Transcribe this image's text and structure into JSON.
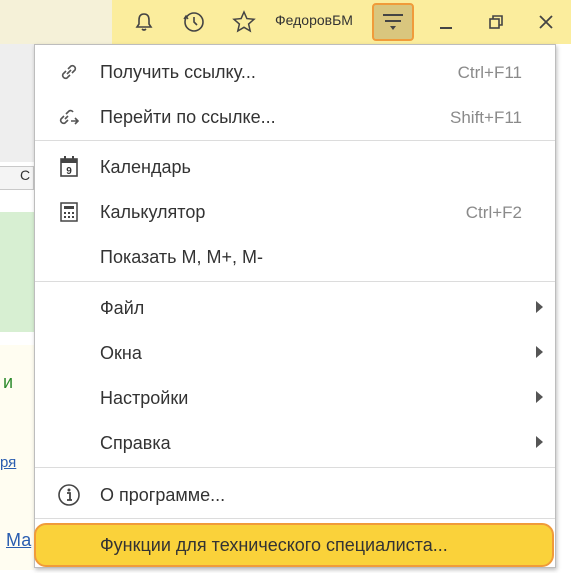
{
  "titlebar": {
    "user_name": "ФедоровБМ",
    "icons": [
      "bell-icon",
      "history-icon",
      "star-icon",
      "menu-icon",
      "minimize-icon",
      "restore-icon",
      "close-icon"
    ]
  },
  "background": {
    "button_label": "С",
    "text_green": "и",
    "link1": "ря",
    "link2": "Ма"
  },
  "menu": {
    "items": [
      {
        "label": "Получить ссылку...",
        "shortcut": "Ctrl+F11",
        "icon": "link-icon"
      },
      {
        "label": "Перейти по ссылке...",
        "shortcut": "Shift+F11",
        "icon": "goto-link-icon"
      },
      {
        "label": "Календарь",
        "shortcut": "",
        "icon": "calendar-icon",
        "icon_text": "9"
      },
      {
        "label": "Калькулятор",
        "shortcut": "Ctrl+F2",
        "icon": "calculator-icon"
      },
      {
        "label": "Показать M, M+, M-",
        "shortcut": "",
        "icon": ""
      },
      {
        "label": "Файл",
        "submenu": true
      },
      {
        "label": "Окна",
        "submenu": true
      },
      {
        "label": "Настройки",
        "submenu": true
      },
      {
        "label": "Справка",
        "submenu": true
      },
      {
        "label": "О программе...",
        "icon": "info-icon"
      },
      {
        "label": "Функции для технического специалиста...",
        "highlighted": true
      }
    ]
  },
  "colors": {
    "titlebar_bg": "#fbed9d",
    "highlight_bg": "#fad23a",
    "highlight_border": "#f09b3a"
  }
}
